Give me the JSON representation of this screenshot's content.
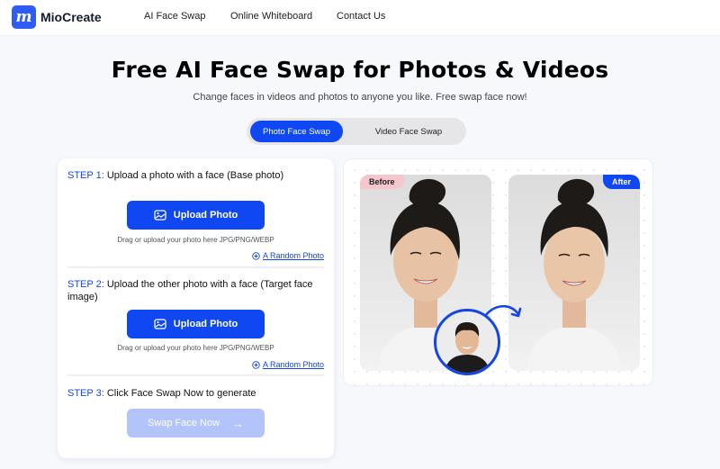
{
  "header": {
    "brand": "MioCreate",
    "logo_glyph": "m",
    "nav": [
      {
        "label": "AI Face Swap"
      },
      {
        "label": "Online Whiteboard"
      },
      {
        "label": "Contact Us"
      }
    ]
  },
  "hero": {
    "title": "Free AI Face Swap for Photos & Videos",
    "subtitle": "Change faces in videos and photos to anyone you like. Free swap face now!"
  },
  "tabs": [
    {
      "label": "Photo Face Swap",
      "active": true
    },
    {
      "label": "Video Face Swap",
      "active": false
    }
  ],
  "steps": [
    {
      "num": "STEP 1:",
      "text": " Upload a photo with a face (Base photo)",
      "button": "Upload Photo",
      "hint": "Drag or upload your photo here JPG/PNG/WEBP",
      "random": "A Random Photo"
    },
    {
      "num": "STEP 2:",
      "text": " Upload the other photo with a face (Target face image)",
      "button": "Upload Photo",
      "hint": "Drag or upload your photo here JPG/PNG/WEBP",
      "random": "A Random Photo"
    },
    {
      "num": "STEP 3:",
      "text": " Click Face Swap Now to generate",
      "button": "Swap Face Now",
      "button_icon": "→"
    }
  ],
  "preview": {
    "before_label": "Before",
    "after_label": "After"
  },
  "colors": {
    "accent": "#0f47f2",
    "disabled_accent": "#b3c4fa",
    "before_badge": "#f5c6cc"
  }
}
